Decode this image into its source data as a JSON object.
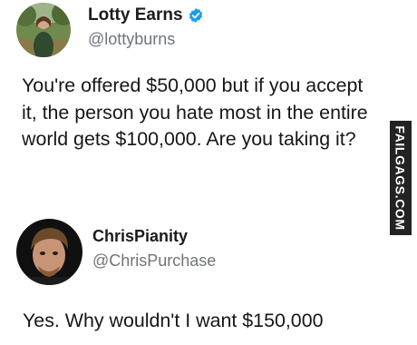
{
  "tweet": {
    "author": {
      "display_name": "Lotty Earns",
      "handle": "@lottyburns",
      "verified": true,
      "verified_color": "#1d9bf0",
      "avatar_icon": "person-outdoors-avatar"
    },
    "text": "You're offered $50,000 but if you accept it, the person you hate most in the entire world gets $100,000. Are you taking it?"
  },
  "watermark": {
    "text": "FAILGAGS.COM"
  },
  "reply": {
    "author": {
      "display_name": "ChrisPianity",
      "handle": "@ChrisPurchase",
      "avatar_icon": "man-portrait-avatar"
    },
    "text": "Yes. Why wouldn't I want $150,000"
  }
}
